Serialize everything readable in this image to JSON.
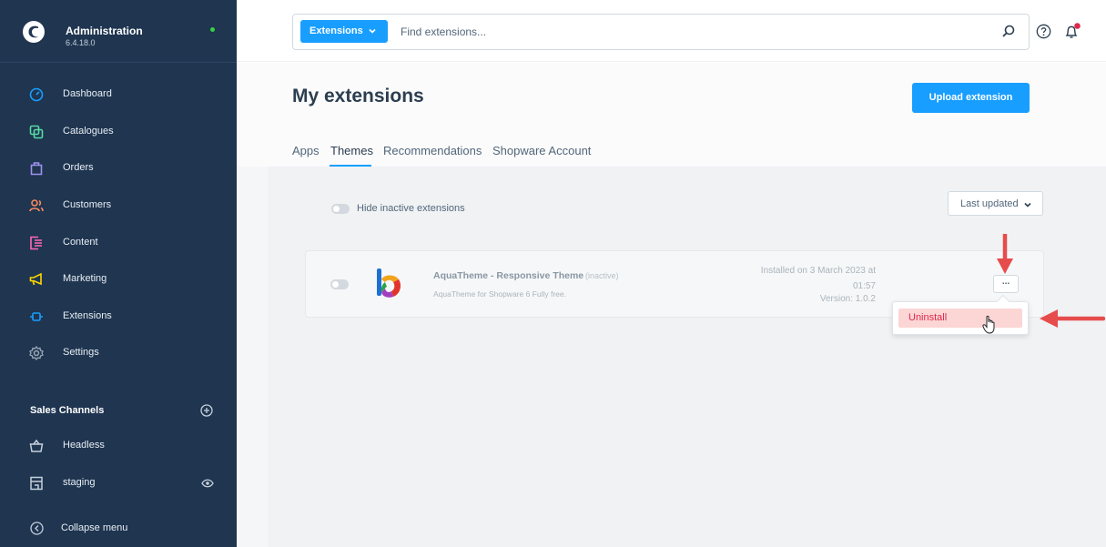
{
  "sidebar": {
    "title": "Administration",
    "version": "6.4.18.0",
    "items": [
      {
        "label": "Dashboard",
        "icon": "dashboard-icon",
        "color": "#189eff"
      },
      {
        "label": "Catalogues",
        "icon": "catalogue-icon",
        "color": "#57d9a3"
      },
      {
        "label": "Orders",
        "icon": "orders-icon",
        "color": "#a092f0"
      },
      {
        "label": "Customers",
        "icon": "customers-icon",
        "color": "#f88962"
      },
      {
        "label": "Content",
        "icon": "content-icon",
        "color": "#ff68b4"
      },
      {
        "label": "Marketing",
        "icon": "marketing-icon",
        "color": "#ffd700"
      },
      {
        "label": "Extensions",
        "icon": "extensions-icon",
        "color": "#189eff"
      },
      {
        "label": "Settings",
        "icon": "settings-icon",
        "color": "#9aa8b5"
      }
    ],
    "sales_channels": {
      "title": "Sales Channels",
      "items": [
        {
          "label": "Headless",
          "icon": "basket-icon"
        },
        {
          "label": "staging",
          "icon": "storefront-icon"
        }
      ]
    },
    "collapse_label": "Collapse menu"
  },
  "topbar": {
    "search_type": "Extensions",
    "search_placeholder": "Find extensions..."
  },
  "page": {
    "title": "My extensions",
    "upload_label": "Upload extension",
    "tabs": [
      "Apps",
      "Themes",
      "Recommendations",
      "Shopware Account"
    ],
    "active_tab": "Themes"
  },
  "filters": {
    "hide_inactive_label": "Hide inactive extensions",
    "sort_label": "Last updated"
  },
  "extension": {
    "name": "AquaTheme - Responsive Theme",
    "status": "(inactive)",
    "description": "AquaTheme for Shopware 6 Fully free.",
    "installed_line1": "Installed on 3 March 2023 at",
    "installed_line2": "01:57",
    "version": "Version: 1.0.2",
    "menu_button": "...",
    "active": false
  },
  "context_menu": {
    "items": [
      "Uninstall"
    ]
  },
  "colors": {
    "sidebar_bg": "#1f3550",
    "accent": "#189eff",
    "danger": "#de294c",
    "annotation_arrow": "#e74c4c"
  }
}
